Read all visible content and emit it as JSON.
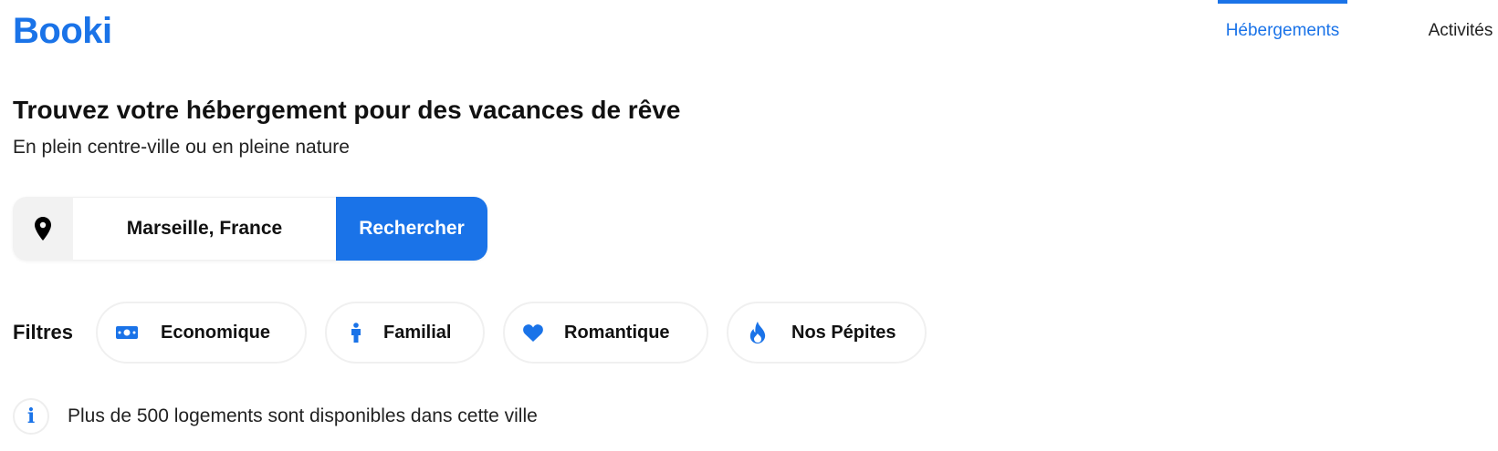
{
  "brand": {
    "logo_text": "Booki",
    "color": "#1A73E8"
  },
  "nav": {
    "tabs": [
      {
        "label": "Hébergements",
        "active": true
      },
      {
        "label": "Activités",
        "active": false
      }
    ]
  },
  "hero": {
    "title": "Trouvez votre hébergement pour des vacances de rêve",
    "subtitle": "En plein centre-ville ou en pleine nature"
  },
  "search": {
    "icon": "location-pin-icon",
    "value": "Marseille, France",
    "button_label": "Rechercher"
  },
  "filters": {
    "label": "Filtres",
    "items": [
      {
        "label": "Economique",
        "icon": "money-icon"
      },
      {
        "label": "Familial",
        "icon": "person-icon"
      },
      {
        "label": "Romantique",
        "icon": "heart-icon"
      },
      {
        "label": "Nos Pépites",
        "icon": "fire-icon"
      }
    ]
  },
  "info": {
    "icon": "info-icon",
    "text": "Plus de 500 logements sont disponibles dans cette ville"
  }
}
